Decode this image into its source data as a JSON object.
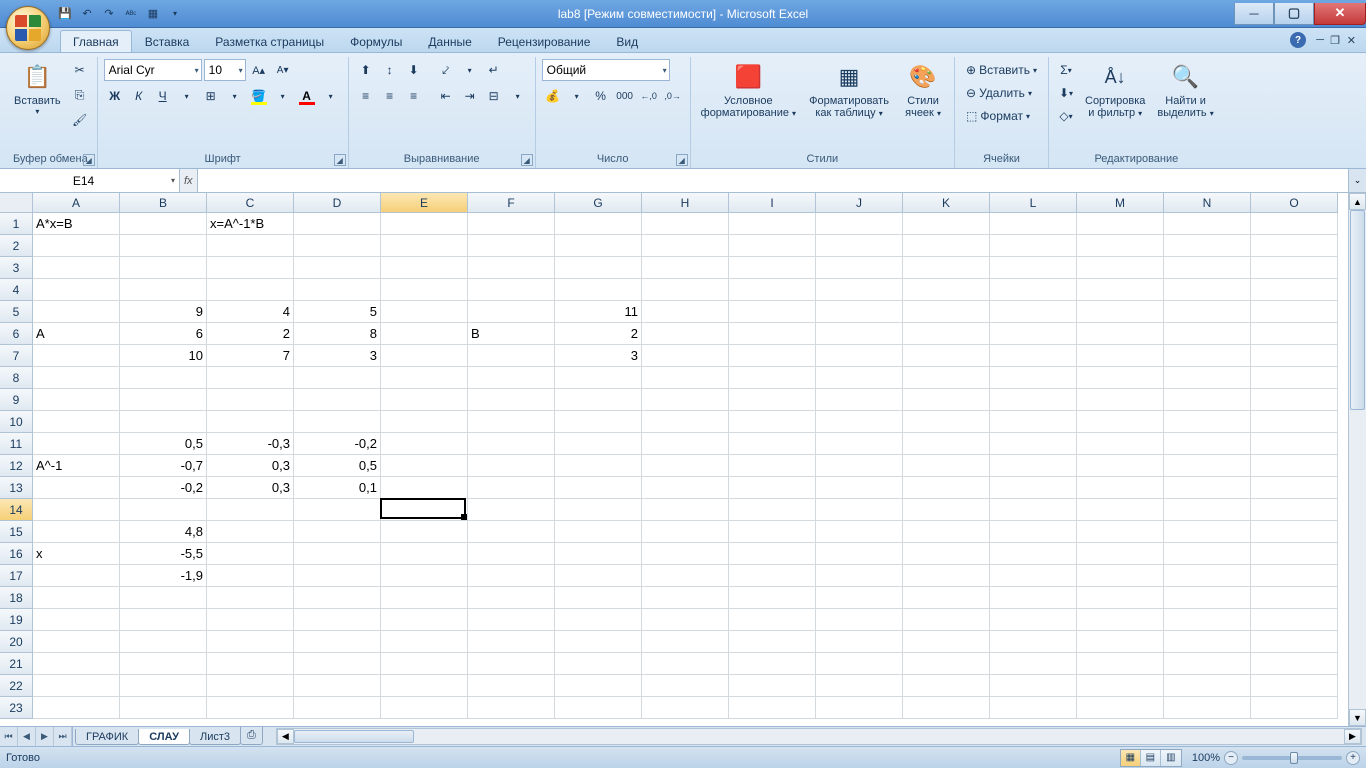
{
  "title": "lab8  [Режим совместимости] - Microsoft Excel",
  "tabs": [
    "Главная",
    "Вставка",
    "Разметка страницы",
    "Формулы",
    "Данные",
    "Рецензирование",
    "Вид"
  ],
  "groups": {
    "clipboard": "Буфер обмена",
    "font": "Шрифт",
    "align": "Выравнивание",
    "number": "Число",
    "styles": "Стили",
    "cells": "Ячейки",
    "editing": "Редактирование"
  },
  "ribbon": {
    "paste": "Вставить",
    "font_name": "Arial Cyr",
    "font_size": "10",
    "number_format": "Общий",
    "cond_fmt_l1": "Условное",
    "cond_fmt_l2": "форматирование",
    "as_table_l1": "Форматировать",
    "as_table_l2": "как таблицу",
    "cell_styles_l1": "Стили",
    "cell_styles_l2": "ячеек",
    "insert": "Вставить",
    "delete": "Удалить",
    "format": "Формат",
    "sort_l1": "Сортировка",
    "sort_l2": "и фильтр",
    "find_l1": "Найти и",
    "find_l2": "выделить"
  },
  "name_box": "E14",
  "formula": "",
  "columns": [
    "A",
    "B",
    "C",
    "D",
    "E",
    "F",
    "G",
    "H",
    "I",
    "J",
    "K",
    "L",
    "M",
    "N",
    "O"
  ],
  "rows_count": 23,
  "sel_col_idx": 4,
  "sel_row_idx": 13,
  "cells": {
    "r1": {
      "A": "A*x=B",
      "C": "x=A^-1*B"
    },
    "r5": {
      "B": "9",
      "C": "4",
      "D": "5",
      "G": "11"
    },
    "r6": {
      "A": "A",
      "B": "6",
      "C": "2",
      "D": "8",
      "F": "B",
      "G": "2"
    },
    "r7": {
      "B": "10",
      "C": "7",
      "D": "3",
      "G": "3"
    },
    "r11": {
      "B": "0,5",
      "C": "-0,3",
      "D": "-0,2"
    },
    "r12": {
      "A": "A^-1",
      "B": "-0,7",
      "C": "0,3",
      "D": "0,5"
    },
    "r13": {
      "B": "-0,2",
      "C": "0,3",
      "D": "0,1"
    },
    "r15": {
      "B": "4,8"
    },
    "r16": {
      "A": "x",
      "B": "-5,5"
    },
    "r17": {
      "B": "-1,9"
    }
  },
  "text_cells": [
    "r1.A",
    "r1.C",
    "r6.A",
    "r6.F",
    "r12.A",
    "r16.A"
  ],
  "sheets": [
    "ГРАФИК",
    "СЛАУ",
    "Лист3"
  ],
  "active_sheet": 1,
  "status": "Готово",
  "zoom": "100%"
}
